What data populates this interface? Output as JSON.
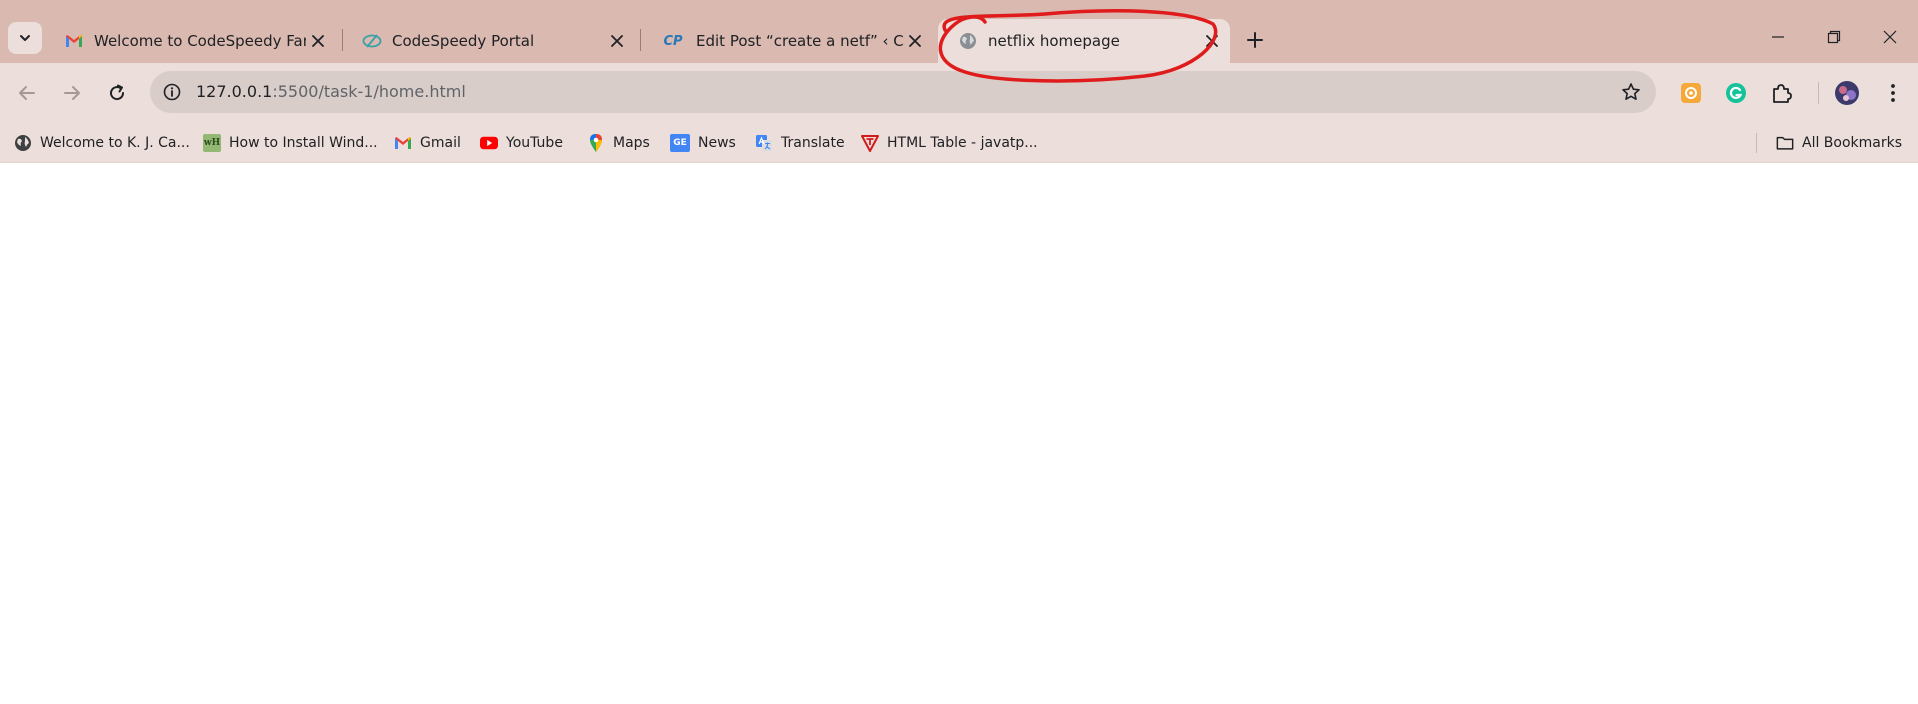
{
  "tabs": [
    {
      "title": "Welcome to CodeSpeedy Family",
      "favicon": "gmail-icon"
    },
    {
      "title": "CodeSpeedy Portal",
      "favicon": "codespeedy-portal-icon"
    },
    {
      "title": "Edit Post “create a netf” ‹ CodeSpeedy",
      "favicon": "cp-icon",
      "favicon_text": "CP"
    },
    {
      "title": "netflix homepage",
      "favicon": "globe-icon",
      "active": true
    }
  ],
  "address_bar": {
    "host": "127.0.0.1",
    "path": ":5500/task-1/home.html"
  },
  "bookmarks": [
    {
      "label": "Welcome to K. J. Ca...",
      "icon": "globe-icon"
    },
    {
      "label": "How to Install Wind...",
      "icon": "wikihow-icon",
      "icon_text": "wH"
    },
    {
      "label": "Gmail",
      "icon": "gmail-icon"
    },
    {
      "label": "YouTube",
      "icon": "youtube-icon"
    },
    {
      "label": "Maps",
      "icon": "maps-icon"
    },
    {
      "label": "News",
      "icon": "news-icon",
      "icon_text": "GE"
    },
    {
      "label": "Translate",
      "icon": "translate-icon"
    },
    {
      "label": "HTML Table - javatp...",
      "icon": "javatpoint-icon"
    }
  ],
  "all_bookmarks": "All Bookmarks",
  "colors": {
    "tabstrip": "#d9b9b0",
    "toolbar": "#ecdfdb",
    "omnibox": "#d9cdca",
    "annotation": "#e01b1b",
    "youtube": "#ff0000",
    "grammarly": "#15c39a"
  }
}
